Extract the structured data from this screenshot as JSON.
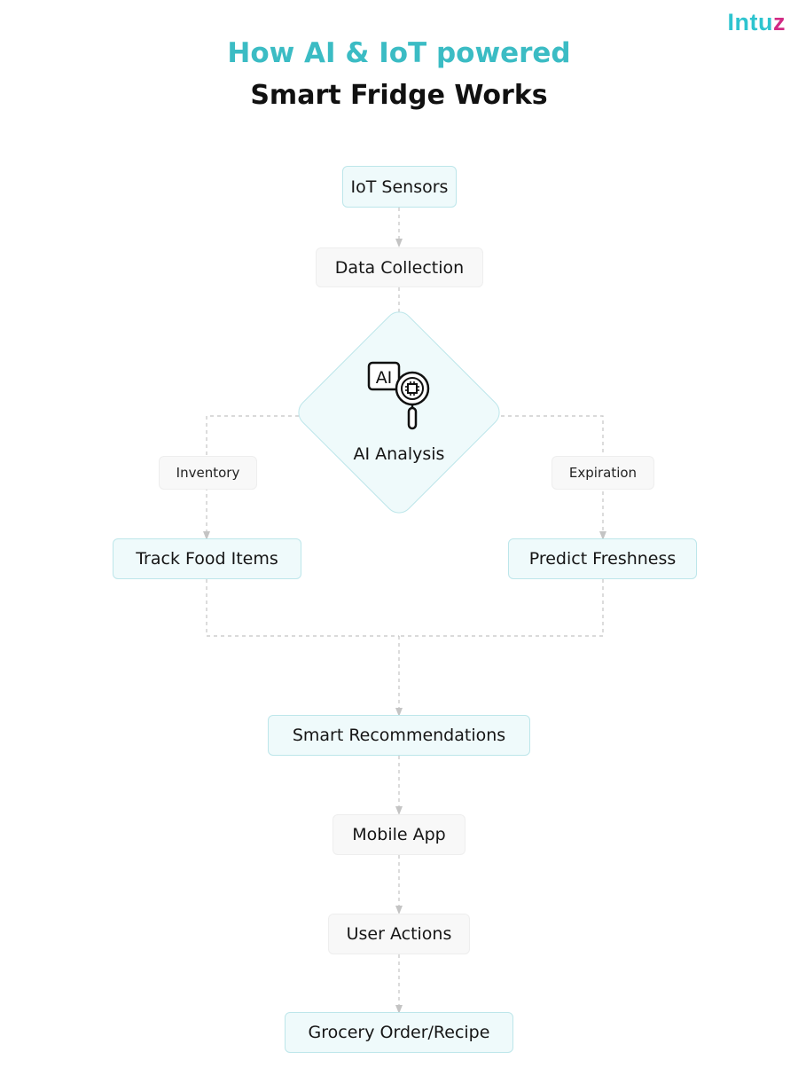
{
  "logo": {
    "text_part1": "Intu",
    "text_part2": "z"
  },
  "title": {
    "line1": "How AI & IoT powered",
    "line2": "Smart Fridge Works"
  },
  "colors": {
    "accent": "#3bbcc4",
    "node_fill": "#effafb",
    "node_border": "#bde6ea",
    "connector": "#c4c4c4",
    "brand_pink": "#d12b84"
  },
  "nodes": {
    "iot_sensors": "IoT Sensors",
    "data_collection": "Data Collection",
    "ai_analysis": {
      "label": "AI Analysis",
      "icon": "ai-magnifier-chip-icon",
      "icon_text": "AI"
    },
    "track_food_items": "Track Food Items",
    "predict_freshness": "Predict Freshness",
    "smart_recommendations": "Smart Recommendations",
    "mobile_app": "Mobile App",
    "user_actions": "User Actions",
    "grocery_order_recipe": "Grocery Order/Recipe"
  },
  "edge_labels": {
    "inventory": "Inventory",
    "expiration": "Expiration"
  }
}
